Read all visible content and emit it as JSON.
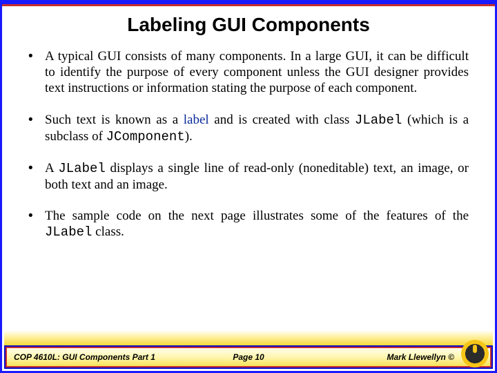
{
  "title": "Labeling GUI Components",
  "bullets": {
    "b1": "A typical GUI consists of many components.  In a large GUI, it can be difficult to identify the purpose of every component unless the GUI designer provides text instructions or information stating the purpose of each component.",
    "b2_pre": "Such text is known as a ",
    "b2_label": "label",
    "b2_mid": " and is created with class ",
    "b2_code1": "JLabel",
    "b2_mid2": " (which is a subclass of ",
    "b2_code2": "JComponent",
    "b2_post": ").",
    "b3_pre": "A ",
    "b3_code": "JLabel",
    "b3_post": " displays a single line of read-only (noneditable) text, an image, or both text and an image.",
    "b4_pre": "The sample code on the next page illustrates some of the features of the ",
    "b4_code": "JLabel",
    "b4_post": " class."
  },
  "footer": {
    "left": "COP 4610L: GUI Components Part 1",
    "center": "Page 10",
    "right": "Mark Llewellyn ©"
  },
  "logo_name": "ucf-pegasus-logo"
}
